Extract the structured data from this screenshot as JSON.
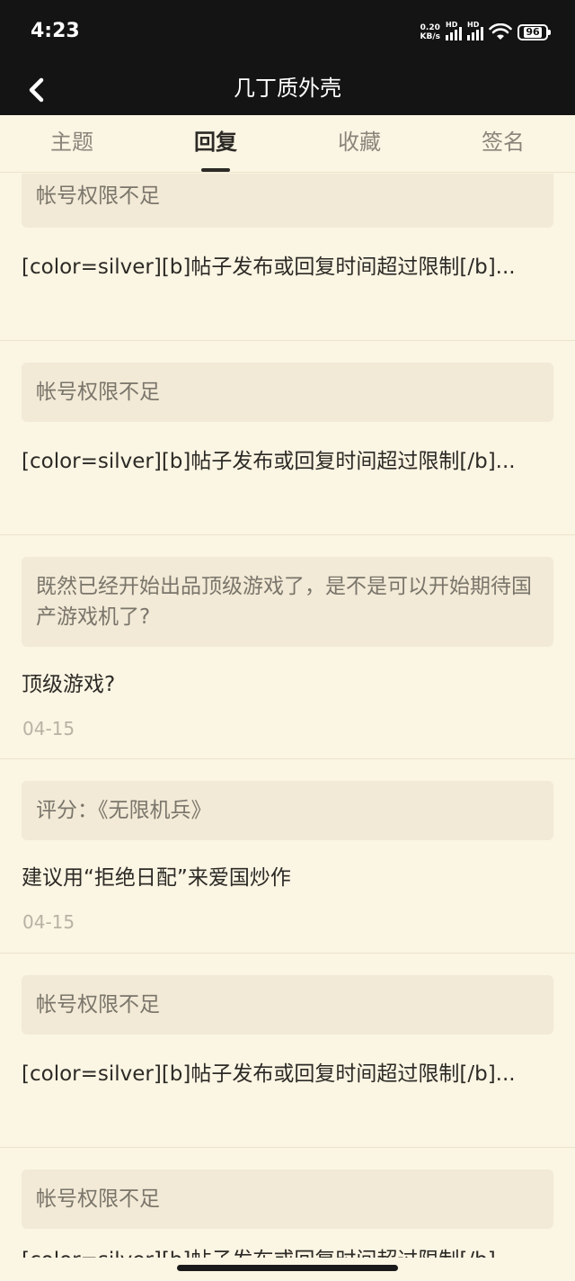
{
  "status_bar": {
    "time": "4:23",
    "net_speed_value": "0.20",
    "net_speed_unit": "KB/s",
    "sim1_label": "HD",
    "sim2_label": "HD",
    "battery": "96"
  },
  "nav": {
    "title": "几丁质外壳",
    "back_icon": "chevron-left-icon"
  },
  "tabs": [
    {
      "label": "主题",
      "active": false
    },
    {
      "label": "回复",
      "active": true
    },
    {
      "label": "收藏",
      "active": false
    },
    {
      "label": "签名",
      "active": false
    }
  ],
  "replies": [
    {
      "quote": "帐号权限不足",
      "text": "[color=silver][b]帖子发布或回复时间超过限制[/b]...",
      "date": ""
    },
    {
      "quote": "帐号权限不足",
      "text": "[color=silver][b]帖子发布或回复时间超过限制[/b]...",
      "date": ""
    },
    {
      "quote": "既然已经开始出品顶级游戏了，是不是可以开始期待国产游戏机了?",
      "text": "顶级游戏?",
      "date": "04-15"
    },
    {
      "quote": "评分：《无限机兵》",
      "text": "建议用“拒绝日配”来爱国炒作",
      "date": "04-15"
    },
    {
      "quote": "帐号权限不足",
      "text": "[color=silver][b]帖子发布或回复时间超过限制[/b]...",
      "date": ""
    },
    {
      "quote": "帐号权限不足",
      "text": "[color=silver][b]帖子发布或回复时间超过限制[/b]...",
      "date": ""
    }
  ],
  "colors": {
    "background": "#fbf5e3",
    "header": "#141414",
    "quote_bg": "#f2ead6"
  }
}
